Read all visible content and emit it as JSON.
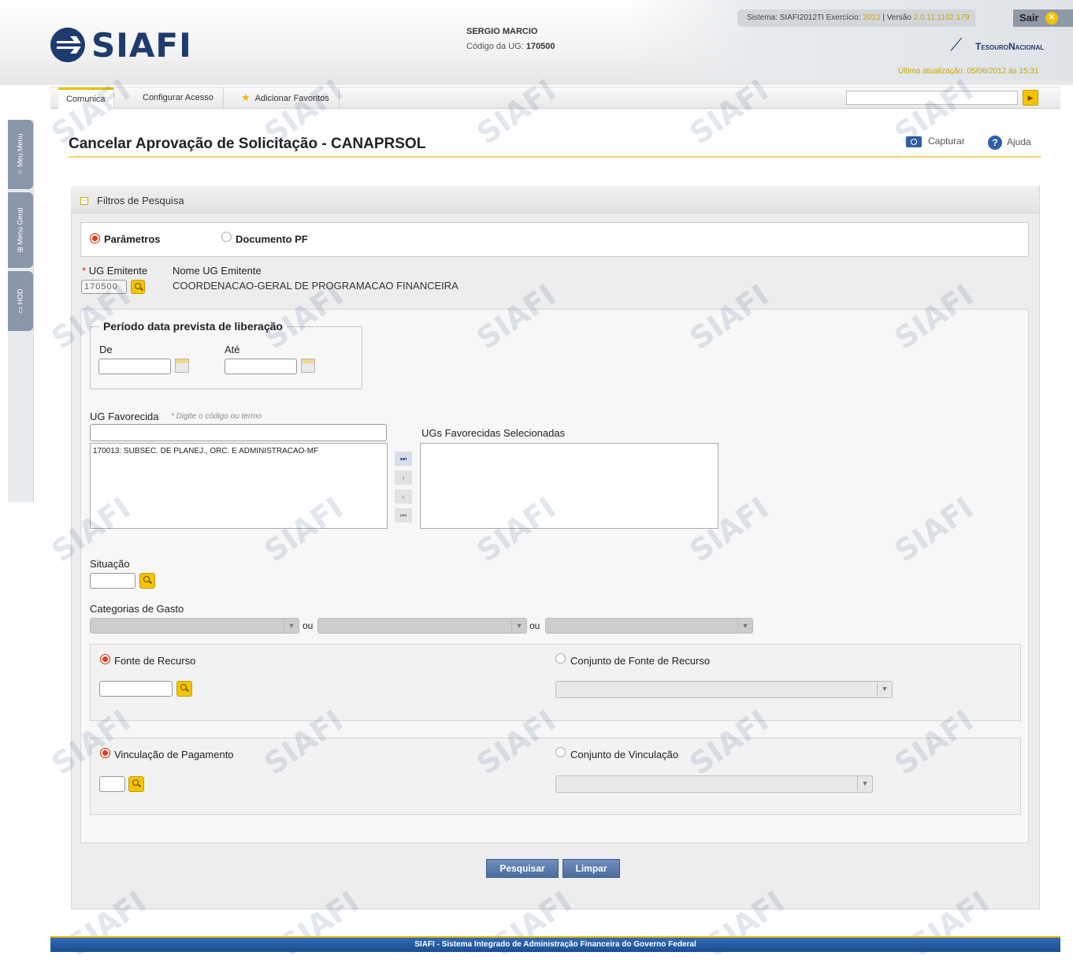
{
  "header": {
    "logo_text": "SIAFI",
    "user_name": "SERGIO MARCIO",
    "ug_label": "Código da UG:",
    "ug_code": "170500",
    "system_info_prefix": "Sistema: SIAFI2012TI Exercício:",
    "system_year": "2012",
    "system_version_label": "| Versão",
    "system_version": "2.0.11.1102.179",
    "exit_label": "Sair",
    "treasury_label": "TesouroNacional",
    "last_update": "Última atualização: 05/06/2012 às 15:31"
  },
  "nav": {
    "tabs": [
      "Comunica",
      "Configurar Acesso",
      "Adicionar Favoritos"
    ]
  },
  "sidebar": {
    "tabs": [
      "Meu Menu",
      "Menu Geral",
      "HOD"
    ]
  },
  "page": {
    "title": "Cancelar Aprovação de Solicitação - CANAPRSOL",
    "capture_label": "Capturar",
    "help_label": "Ajuda"
  },
  "filters": {
    "panel_title": "Filtros de Pesquisa",
    "mode_parametros": "Parâmetros",
    "mode_documento": "Documento PF",
    "ug_emitente_label": "UG Emitente",
    "ug_emitente_value": "170500",
    "nome_ug_label": "Nome UG Emitente",
    "nome_ug_value": "COORDENACAO-GERAL DE PROGRAMACAO FINANCEIRA",
    "periodo_legend": "Período data prevista de liberação",
    "de_label": "De",
    "ate_label": "Até",
    "ug_favorecida_label": "UG Favorecida",
    "ug_favorecida_hint": "* Digite o código ou termo",
    "ug_favorecida_options": [
      "170013: SUBSEC. DE PLANEJ., ORC. E ADMINISTRACAO-MF"
    ],
    "ugs_selecionadas_label": "UGs Favorecidas Selecionadas",
    "transfer_buttons": [
      "⏭",
      "›",
      "‹",
      "⏮"
    ],
    "situacao_label": "Situação",
    "categorias_label": "Categorias de Gasto",
    "ou": "ou",
    "fonte_label": "Fonte de Recurso",
    "conj_fonte_label": "Conjunto de Fonte de Recurso",
    "vinculacao_label": "Vinculação de Pagamento",
    "conj_vinculacao_label": "Conjunto de Vinculação",
    "pesquisar": "Pesquisar",
    "limpar": "Limpar"
  },
  "footer": {
    "text": "SIAFI - Sistema Integrado de Administração Financeira do Governo Federal"
  },
  "colors": {
    "accent_yellow": "#f5c400",
    "brand_blue": "#1e3b6e",
    "button_blue": "#5a79a9"
  }
}
